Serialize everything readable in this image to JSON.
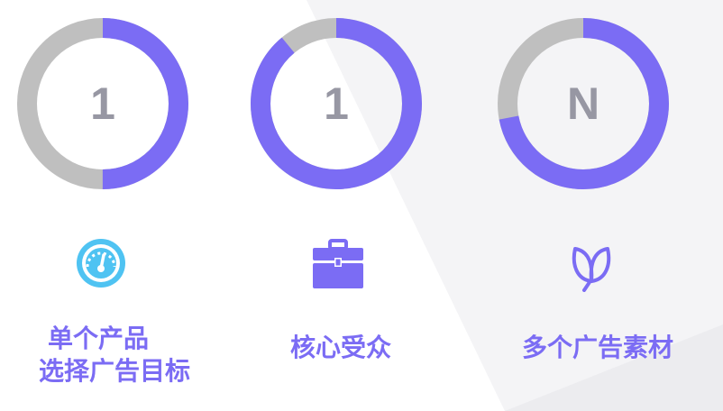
{
  "colors": {
    "accent": "#7b6cf4",
    "ring_track": "#bfbfbf",
    "number": "#9797a3",
    "gauge_icon": "#4fc3f2",
    "background_shade": "#f4f4f6"
  },
  "cards": [
    {
      "number": "1",
      "progress": 0.5,
      "icon": "speedometer-icon",
      "caption_lines": [
        "单个产品",
        "选择广告目标"
      ]
    },
    {
      "number": "1",
      "progress": 0.89,
      "icon": "briefcase-icon",
      "caption_lines": [
        "核心受众"
      ]
    },
    {
      "number": "N",
      "progress": 0.72,
      "icon": "leaf-icon",
      "caption_lines": [
        "多个广告素材"
      ]
    }
  ]
}
